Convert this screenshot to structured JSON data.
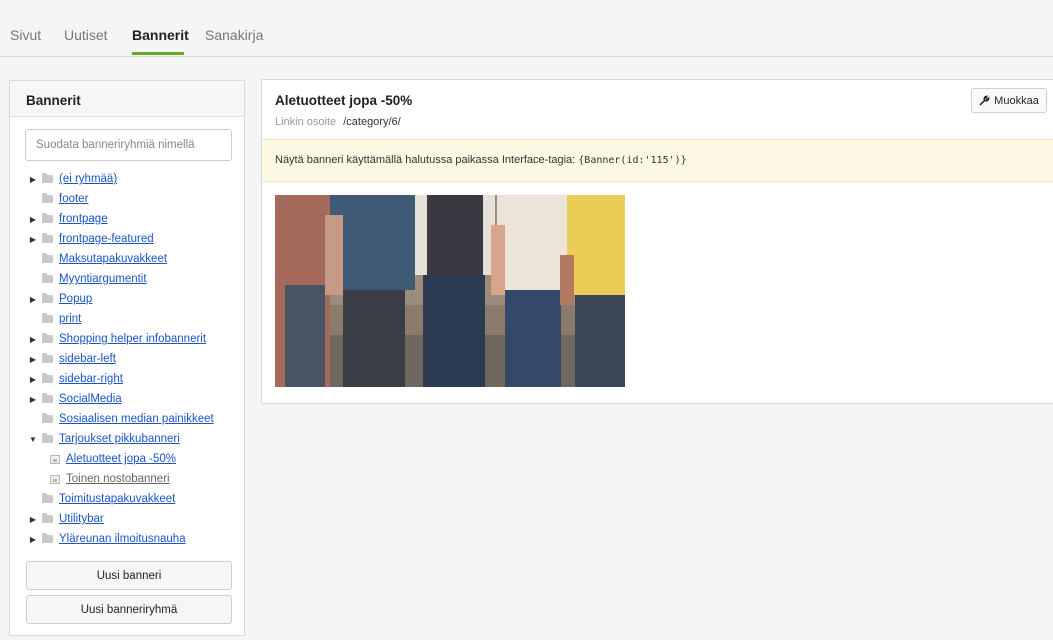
{
  "tabs": [
    {
      "label": "Sivut"
    },
    {
      "label": "Uutiset"
    },
    {
      "label": "Bannerit"
    },
    {
      "label": "Sanakirja"
    }
  ],
  "left": {
    "title": "Bannerit",
    "filter_placeholder": "Suodata banneriryhmiä nimellä",
    "tree": [
      {
        "label": "(ei ryhmää)",
        "caret": "▶",
        "icon": "folder-icon"
      },
      {
        "label": "footer",
        "caret": "",
        "icon": "folder-icon"
      },
      {
        "label": "frontpage",
        "caret": "▶",
        "icon": "folder-icon"
      },
      {
        "label": "frontpage-featured",
        "caret": "▶",
        "icon": "folder-icon"
      },
      {
        "label": "Maksutapakuvakkeet",
        "caret": "",
        "icon": "folder-icon"
      },
      {
        "label": "Myyntiargumentit",
        "caret": "",
        "icon": "folder-icon"
      },
      {
        "label": "Popup",
        "caret": "▶",
        "icon": "folder-icon"
      },
      {
        "label": "print",
        "caret": "",
        "icon": "folder-icon"
      },
      {
        "label": "Shopping helper infobannerit",
        "caret": "▶",
        "icon": "folder-icon"
      },
      {
        "label": "sidebar-left",
        "caret": "▶",
        "icon": "folder-icon"
      },
      {
        "label": "sidebar-right",
        "caret": "▶",
        "icon": "folder-icon"
      },
      {
        "label": "SocialMedia",
        "caret": "▶",
        "icon": "folder-icon"
      },
      {
        "label": "Sosiaalisen median painikkeet",
        "caret": "",
        "icon": "folder-icon"
      },
      {
        "label": "Tarjoukset pikkubanneri",
        "caret": "▼",
        "icon": "folder-icon"
      },
      {
        "label": "Aletuotteet jopa -50%",
        "caret": "",
        "icon": "image-icon"
      },
      {
        "label": "Toinen nostobanneri",
        "caret": "",
        "icon": "image-icon"
      },
      {
        "label": "Toimitustapakuvakkeet",
        "caret": "",
        "icon": "folder-icon"
      },
      {
        "label": "Utilitybar",
        "caret": "▶",
        "icon": "folder-icon"
      },
      {
        "label": "Yläreunan ilmoitusnauha",
        "caret": "▶",
        "icon": "folder-icon"
      }
    ],
    "new_banner": "Uusi banneri",
    "new_group": "Uusi banneriryhmä"
  },
  "detail": {
    "title": "Aletuotteet jopa -50%",
    "link_label": "Linkin osoite",
    "link_value": "/category/6/",
    "edit_label": "Muokkaa",
    "notice_text": "Näytä banneri käyttämällä halutussa paikassa Interface-tagia: ",
    "notice_code": "{Banner(id:'115')}"
  },
  "colors": {
    "accent": "#6aa82e",
    "link": "#1a55c8",
    "notice_bg": "#fcf8e3"
  }
}
